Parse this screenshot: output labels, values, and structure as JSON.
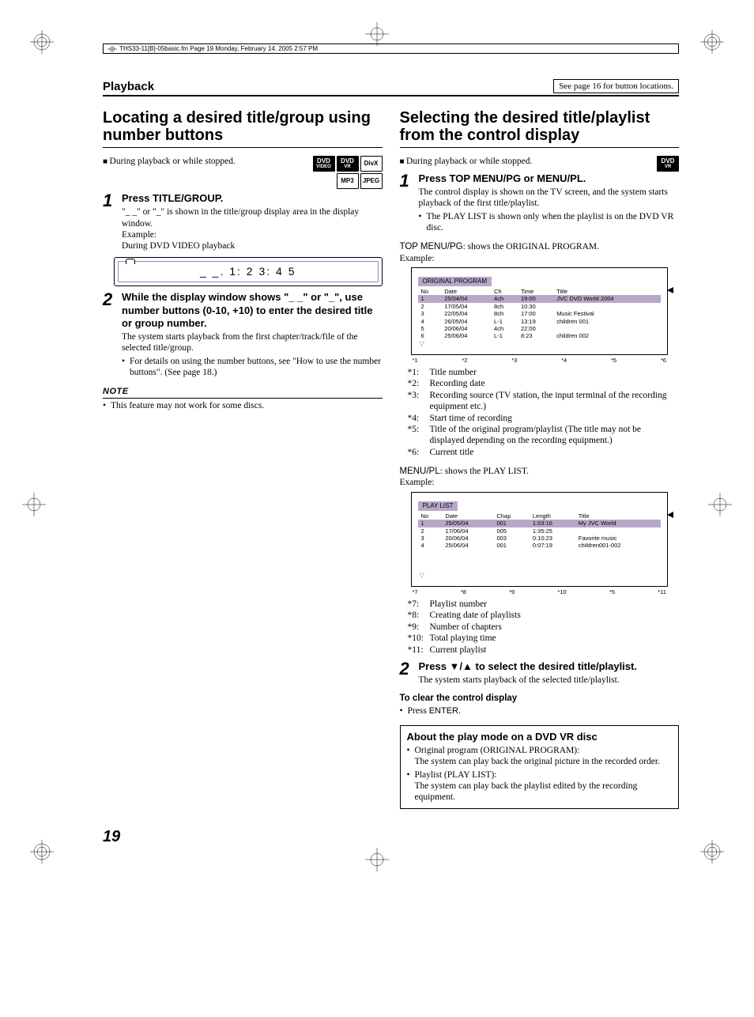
{
  "meta": {
    "file_header": "THS33-11[B]-05basic.fm  Page 19  Monday, February 14, 2005  2:57 PM"
  },
  "header": {
    "section": "Playback",
    "see_page": "See page 16 for button locations."
  },
  "left": {
    "heading": "Locating a desired title/group using number buttons",
    "context": "During playback or while stopped.",
    "badges": [
      "DVD VIDEO",
      "DVD VR",
      "DivX",
      "MP3",
      "JPEG"
    ],
    "step1": {
      "num": "1",
      "title": "Press TITLE/GROUP.",
      "body1": "\"_ _\" or \"_\" is shown in the title/group display area in the display window.",
      "body2": "Example:",
      "body3": "During DVD VIDEO playback",
      "display": "_  _.     1: 2  3: 4  5"
    },
    "step2": {
      "num": "2",
      "title": "While the display window shows \"_ _\" or \"_\", use number buttons (0-10, +10) to enter the desired title or group number.",
      "body1": "The system starts playback from the first chapter/track/file of the selected title/group.",
      "bullet1": "For details on using the number buttons, see \"How to use the number buttons\". (See page 18.)"
    },
    "note": {
      "label": "NOTE",
      "item1": "This feature may not work for some discs."
    }
  },
  "right": {
    "heading": "Selecting the desired title/playlist from the control display",
    "context": "During playback or while stopped.",
    "badges": [
      "DVD VR"
    ],
    "step1": {
      "num": "1",
      "title": "Press TOP MENU/PG or MENU/PL.",
      "body1": "The control display is shown on the TV screen, and the system starts playback of the first title/playlist.",
      "bullet1": "The PLAY LIST is shown only when the playlist is on the DVD VR disc.",
      "top_menu_label": "TOP MENU/PG",
      "top_menu_desc": ": shows the ORIGINAL PROGRAM.",
      "example": "Example:"
    },
    "original_program": {
      "title": "ORIGINAL PROGRAM",
      "headers": [
        "No",
        "Date",
        "Ch",
        "Time",
        "Title"
      ],
      "rows": [
        {
          "no": "1",
          "date": "25/04/04",
          "ch": "4ch",
          "time": "19:00",
          "title": "JVC DVD World 2004",
          "hl": true
        },
        {
          "no": "2",
          "date": "17/05/04",
          "ch": "8ch",
          "time": "10:30",
          "title": ""
        },
        {
          "no": "3",
          "date": "22/05/04",
          "ch": "8ch",
          "time": "17:00",
          "title": "Music Festival"
        },
        {
          "no": "4",
          "date": "26/05/04",
          "ch": "L-1",
          "time": "13:19",
          "title": "children 001"
        },
        {
          "no": "5",
          "date": "20/06/04",
          "ch": "4ch",
          "time": "22:00",
          "title": ""
        },
        {
          "no": "6",
          "date": "25/06/04",
          "ch": "L-1",
          "time": "8:23",
          "title": "children 002"
        }
      ],
      "marks": [
        "*1",
        "*2",
        "*3",
        "*4",
        "*5",
        "*6"
      ]
    },
    "footnotes1": [
      {
        "k": "*1:",
        "v": "Title number"
      },
      {
        "k": "*2:",
        "v": "Recording date"
      },
      {
        "k": "*3:",
        "v": "Recording source (TV station, the input terminal of the recording equipment etc.)"
      },
      {
        "k": "*4:",
        "v": "Start time of recording"
      },
      {
        "k": "*5:",
        "v": "Title of the original program/playlist (The title may not be displayed depending on the recording equipment.)"
      },
      {
        "k": "*6:",
        "v": "Current title"
      }
    ],
    "menu_pl_label": "MENU/PL",
    "menu_pl_desc": ": shows the PLAY LIST.",
    "playlist": {
      "title": "PLAY LIST",
      "headers": [
        "No",
        "Date",
        "Chap",
        "Length",
        "Title"
      ],
      "rows": [
        {
          "no": "1",
          "date": "25/05/04",
          "chap": "001",
          "len": "1:03:16",
          "title": "My JVC World",
          "hl": true
        },
        {
          "no": "2",
          "date": "17/06/04",
          "chap": "005",
          "len": "1:35:25",
          "title": ""
        },
        {
          "no": "3",
          "date": "20/06/04",
          "chap": "003",
          "len": "0:10:23",
          "title": "Favorite music"
        },
        {
          "no": "4",
          "date": "25/06/04",
          "chap": "001",
          "len": "0:07:19",
          "title": "children001-002"
        }
      ],
      "marks": [
        "*7",
        "*8",
        "*9",
        "*10",
        "*5",
        "*11"
      ]
    },
    "footnotes2": [
      {
        "k": "*7:",
        "v": "Playlist number"
      },
      {
        "k": "*8:",
        "v": "Creating date of playlists"
      },
      {
        "k": "*9:",
        "v": "Number of chapters"
      },
      {
        "k": "*10:",
        "v": "Total playing time"
      },
      {
        "k": "*11:",
        "v": "Current playlist"
      }
    ],
    "step2": {
      "num": "2",
      "title_pre": "Press ",
      "title_post": " to select the desired title/playlist.",
      "arrows": "▼/▲",
      "body1": "The system starts playback of the selected title/playlist."
    },
    "clear": {
      "title": "To clear the control display",
      "item1_pre": "Press ",
      "item1_btn": "ENTER",
      "item1_post": "."
    },
    "about": {
      "title": "About the play mode on a DVD VR disc",
      "op_label": "Original program (ORIGINAL PROGRAM):",
      "op_body": "The system can play back the original picture in the recorded order.",
      "pl_label": "Playlist (PLAY LIST):",
      "pl_body": "The system can play back the playlist edited by the recording equipment."
    }
  },
  "page_number": "19"
}
